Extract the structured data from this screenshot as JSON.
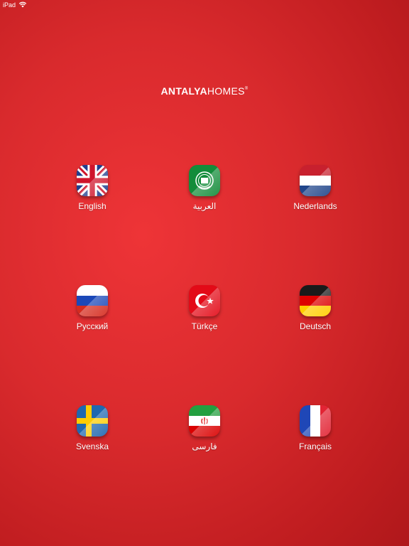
{
  "status_bar": {
    "device": "iPad"
  },
  "logo": {
    "bold": "ANTALYA",
    "light": "HOMES",
    "mark": "®"
  },
  "languages": [
    {
      "label": "English",
      "icon": "uk-flag-icon"
    },
    {
      "label": "العربية",
      "icon": "arab-league-flag-icon"
    },
    {
      "label": "Nederlands",
      "icon": "netherlands-flag-icon"
    },
    {
      "label": "Русский",
      "icon": "russia-flag-icon"
    },
    {
      "label": "Türkçe",
      "icon": "turkey-flag-icon"
    },
    {
      "label": "Deutsch",
      "icon": "germany-flag-icon"
    },
    {
      "label": "Svenska",
      "icon": "sweden-flag-icon"
    },
    {
      "label": "فارسی",
      "icon": "iran-flag-icon"
    },
    {
      "label": "Français",
      "icon": "france-flag-icon"
    }
  ],
  "colors": {
    "background": "#d92a2d",
    "text": "#ffffff"
  }
}
